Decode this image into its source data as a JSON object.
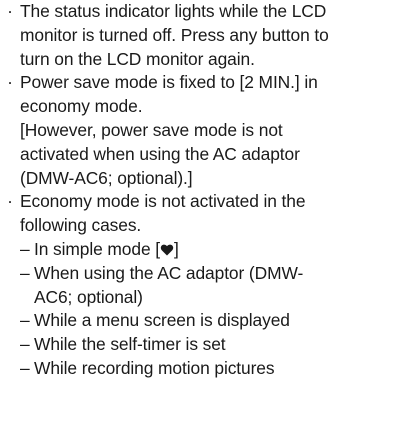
{
  "bullet_glyph": "·",
  "dash_glyph": "–",
  "items": [
    {
      "lines": [
        "The status indicator lights while the LCD",
        "monitor is turned off. Press any button to",
        "turn on the LCD monitor again."
      ]
    },
    {
      "lines": [
        "Power save mode is fixed to [2 MIN.] in",
        "economy mode.",
        "[However, power save mode is not",
        "activated when using the AC adaptor",
        "(DMW-AC6; optional).]"
      ]
    },
    {
      "lines": [
        "Economy mode is not activated in the",
        "following cases."
      ],
      "cases": {
        "simple_mode_prefix": "In simple mode [",
        "simple_mode_suffix": "]",
        "simple_mode_icon": "heart-icon",
        "ac_adaptor_line1": "When using the AC adaptor (DMW-",
        "ac_adaptor_line2": "AC6; optional)",
        "menu_screen": "While a menu screen is displayed",
        "self_timer": "While the self-timer is set",
        "motion_pictures": "While recording motion pictures"
      }
    }
  ]
}
